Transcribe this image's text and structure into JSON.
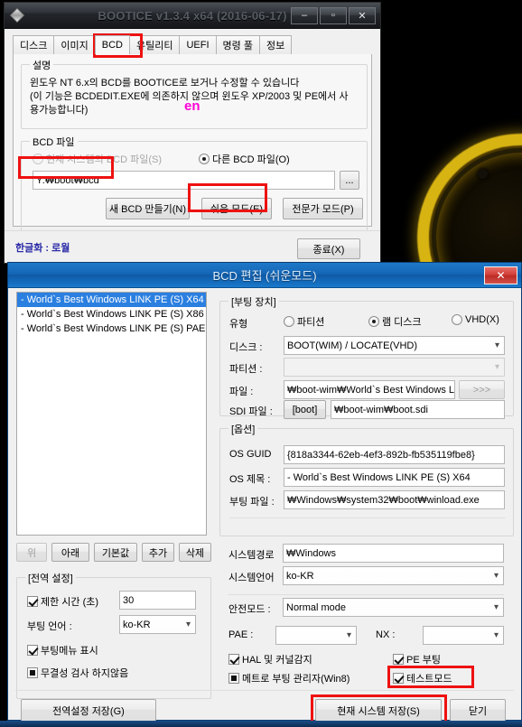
{
  "window1": {
    "title": "BOOTICE v1.3.4 x64 (2016-06-17)",
    "app_icon": "diamond-icon",
    "sys": {
      "minimize": "–",
      "maximize": "▫",
      "close": "✕"
    },
    "tabs": [
      {
        "label": "디스크"
      },
      {
        "label": "이미지"
      },
      {
        "label": "BCD"
      },
      {
        "label": "유틸리티"
      },
      {
        "label": "UEFI"
      },
      {
        "label": "명령 풀"
      },
      {
        "label": "정보"
      }
    ],
    "active_tab": "BCD",
    "desc_group": {
      "title": "설명",
      "line1": "윈도우 NT 6.x의 BCD를 BOOTICE로 보거나 수정할 수 있습니다",
      "line2": "(이 기능은 BCDEDIT.EXE에 의존하지 않으며 윈도우 XP/2003 및 PE에서 사",
      "line3": "용가능합니다)",
      "overlay_text": "en",
      "overlay_color": "#ff00d8"
    },
    "bcd_group": {
      "title": "BCD 파일",
      "radio_current": "현재 시스템의 BCD 파일(S)",
      "radio_other": "다른 BCD 파일(O)",
      "selected": "other",
      "path_value": "Y:₩boot₩bcd",
      "browse_label": "...",
      "buttons": [
        {
          "label": "새 BCD 만들기(N)",
          "highlight": false
        },
        {
          "label": "쉬운 모드(E)",
          "highlight": true
        },
        {
          "label": "전문가 모드(P)",
          "highlight": false
        }
      ]
    },
    "statusbar": {
      "credit": "한글화 : 로월",
      "exit_label": "종료(X)"
    }
  },
  "window2": {
    "title": "BCD 편집 (쉬운모드)",
    "close_label": "✕",
    "os_list": [
      {
        "label": "- World`s Best Windows LINK PE (S) X64",
        "selected": true
      },
      {
        "label": "- World`s Best Windows LINK PE (S) X86",
        "selected": false
      },
      {
        "label": "- World`s Best Windows LINK PE (S) PAE",
        "selected": false
      }
    ],
    "list_buttons": [
      {
        "label": "위",
        "disabled": true
      },
      {
        "label": "아래",
        "disabled": false
      },
      {
        "label": "기본값",
        "disabled": false
      },
      {
        "label": "추가",
        "disabled": false
      },
      {
        "label": "삭제",
        "disabled": false
      }
    ],
    "global_group": {
      "title": "[전역 설정]",
      "timeout_label": "제한 시간 (초)",
      "timeout_checked": true,
      "timeout_value": "30",
      "boot_lang_label": "부팅 언어 :",
      "boot_lang_value": "ko-KR",
      "show_menu_label": "부팅메뉴 표시",
      "show_menu_checked": true,
      "no_integrity_label": "무결성 검사 하지않음",
      "no_integrity_state": "indeterminate"
    },
    "boot_device_group": {
      "title": "[부팅 장치]",
      "type_label": "유형",
      "type_options": [
        {
          "label": "파티션",
          "selected": false
        },
        {
          "label": "램 디스크",
          "selected": true
        },
        {
          "label": "VHD(X)",
          "selected": false
        }
      ],
      "disk_label": "디스크 :",
      "disk_value": "BOOT(WIM) / LOCATE(VHD)",
      "partition_label": "파티션 :",
      "partition_value": "",
      "partition_disabled": true,
      "file_label": "파일 :",
      "file_value": "₩boot-wim₩World`s Best Windows LII",
      "file_browse_label": ">>>",
      "sdi_label": "SDI 파일 :",
      "sdi_button": "[boot]",
      "sdi_value": "₩boot-wim₩boot.sdi"
    },
    "options_group": {
      "title": "[옵션]",
      "guid_label": "OS GUID",
      "guid_value": "{818a3344-62eb-4ef3-892b-fb535119fbe8}",
      "os_title_label": "OS 제목 :",
      "os_title_value": "- World`s Best Windows LINK PE (S) X64",
      "boot_file_label": "부팅 파일 :",
      "boot_file_value": "₩Windows₩system32₩boot₩winload.exe",
      "syspath_label": "시스템경로",
      "syspath_value": "₩Windows",
      "syslang_label": "시스템언어",
      "syslang_value": "ko-KR",
      "safemode_label": "안전모드 :",
      "safemode_value": "Normal mode",
      "pae_label": "PAE :",
      "pae_value": "",
      "nx_label": "NX :",
      "nx_value": "",
      "hal_label": "HAL 및 커널감지",
      "hal_checked": true,
      "pe_label": "PE 부팅",
      "pe_checked": true,
      "metro_label": "메트로 부팅 관리자(Win8)",
      "metro_state": "indeterminate",
      "testmode_label": "테스트모드",
      "testmode_checked": true,
      "testmode_highlight": true
    },
    "footer": {
      "save_global_label": "전역설정 저장(G)",
      "save_current_label": "현재 시스템 저장(S)",
      "save_current_highlight": true,
      "close_label": "닫기"
    }
  },
  "annotations": {
    "highlight_color": "#ee1111",
    "boxes": [
      "tab-bcd",
      "bcd-path-input",
      "easy-mode-button",
      "testmode-checkbox",
      "save-current-button"
    ]
  }
}
